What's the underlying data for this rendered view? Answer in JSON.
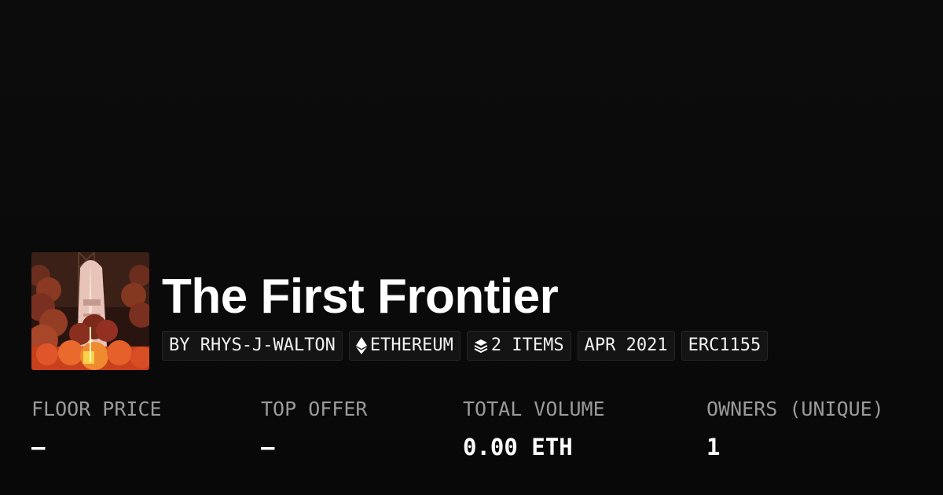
{
  "collection": {
    "title": "The First Frontier",
    "avatar_alt": "collection-artwork"
  },
  "badges": [
    {
      "label": "BY RHYS-J-WALTON",
      "icon": ""
    },
    {
      "label": "ETHEREUM",
      "icon": "ethereum-icon"
    },
    {
      "label": "2 ITEMS",
      "icon": "layers-icon"
    },
    {
      "label": "APR 2021",
      "icon": ""
    },
    {
      "label": "ERC1155",
      "icon": ""
    }
  ],
  "stats": [
    {
      "label": "FLOOR PRICE",
      "value": "–"
    },
    {
      "label": "TOP OFFER",
      "value": "–"
    },
    {
      "label": "TOTAL VOLUME",
      "value": "0.00 ETH"
    },
    {
      "label": "OWNERS (UNIQUE)",
      "value": "1"
    }
  ],
  "colors": {
    "background": "#0b0b0b",
    "badge_background": "#141414",
    "label_gray": "#9a9a9a",
    "text_white": "#ffffff"
  }
}
